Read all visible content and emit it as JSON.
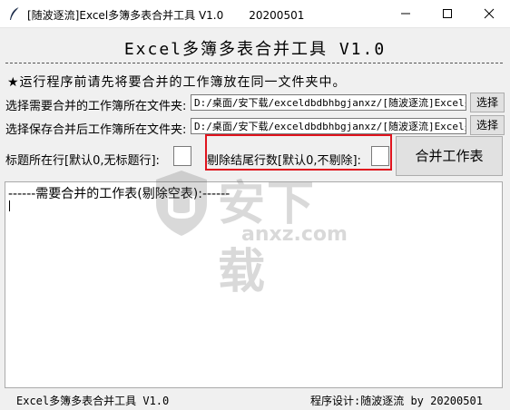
{
  "window": {
    "title": "[随波逐流]Excel多簿多表合并工具 V1.0",
    "date": "20200501",
    "controls": {
      "minimize": "minimize-icon",
      "maximize": "maximize-icon",
      "close": "close-icon"
    }
  },
  "header": {
    "title": "Excel多簿多表合并工具 V1.0",
    "notice": "★运行程序前请先将要合并的工作簿放在同一文件夹中。"
  },
  "source": {
    "label": "选择需要合并的工作簿所在文件夹:",
    "value": "D:/桌面/安下载/exceldbdbhbgjanxz/[随波逐流]Excel多",
    "button": "选择"
  },
  "target": {
    "label": "选择保存合并后工作簿所在文件夹:",
    "value": "D:/桌面/安下载/exceldbdbhbgjanxz/[随波逐流]Excel多",
    "button": "选择"
  },
  "options": {
    "title_row_label": "标题所在行[默认0,无标题行]:",
    "title_row_value": "",
    "footer_rows_label": "剔除结尾行数[默认0,不剔除]:",
    "footer_rows_value": "",
    "merge_button": "合并工作表"
  },
  "output": {
    "header_line": "------需要合并的工作表(剔除空表):------"
  },
  "watermark": {
    "main": "安下载",
    "sub": "anxz.com"
  },
  "footer": {
    "left": "Excel多簿多表合并工具 V1.0",
    "right": "程序设计:随波逐流 by 20200501"
  },
  "colors": {
    "highlight": "#e0141e"
  }
}
